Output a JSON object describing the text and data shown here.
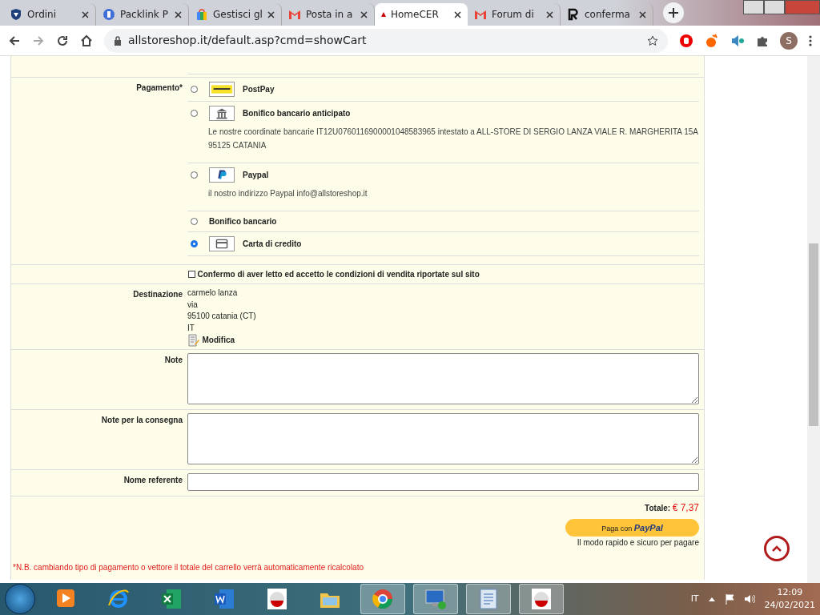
{
  "browser": {
    "tabs": [
      {
        "title": "Ordini",
        "selected": false
      },
      {
        "title": "Packlink P",
        "selected": false
      },
      {
        "title": "Gestisci gl",
        "selected": false
      },
      {
        "title": "Posta in a",
        "selected": false
      },
      {
        "title": "HomeCER",
        "selected": true
      },
      {
        "title": "Forum di",
        "selected": false
      },
      {
        "title": "conferma",
        "selected": false
      }
    ],
    "address": "allstoreshop.it/default.asp?cmd=showCart",
    "profile": "S"
  },
  "payment": {
    "label": "Pagamento*",
    "options": [
      {
        "title": "PostPay",
        "selected": false
      },
      {
        "title": "Bonifico bancario anticipato",
        "note": "Le nostre coordinate bancarie IT12U0760116900001048583965 intestato a ALL-STORE DI SERGIO LANZA VIALE R. MARGHERITA 15A 95125 CATANIA",
        "selected": false
      },
      {
        "title": "Paypal",
        "note": "il nostro indirizzo Paypal info@allstoreshop.it",
        "selected": false
      },
      {
        "title": "Bonifico bancario",
        "selected": false
      },
      {
        "title": "Carta di credito",
        "selected": true
      }
    ]
  },
  "terms": {
    "label": "Confermo di aver letto ed accetto le condizioni di vendita riportate sul sito",
    "checked": false
  },
  "destination": {
    "label": "Destinazione",
    "lines": [
      "carmelo lanza",
      "via",
      "95100 catania (CT)",
      "IT"
    ],
    "edit_link": "Modifica"
  },
  "fields": [
    {
      "label": "Note",
      "kind": "textarea"
    },
    {
      "label": "Note per la consegna",
      "kind": "textarea"
    },
    {
      "label": "Nome referente",
      "kind": "input"
    }
  ],
  "total": {
    "label": "Totale:",
    "value": "€ 7,37"
  },
  "paypal": {
    "prefix": "Paga con",
    "brand": "PayPal",
    "caption": "Il modo rapido e sicuro per pagare"
  },
  "footnote": "*N.B. cambiando tipo di pagamento o vettore il totale del carrello verrà automaticamente ricalcolato",
  "taskbar": {
    "apps": [
      {
        "kind": "media",
        "selected": false
      },
      {
        "kind": "ie",
        "selected": false
      },
      {
        "kind": "excel",
        "selected": false
      },
      {
        "kind": "word",
        "selected": false
      },
      {
        "kind": "app",
        "selected": false
      },
      {
        "kind": "folder",
        "selected": false
      },
      {
        "kind": "chrome",
        "selected": true
      },
      {
        "kind": "remote",
        "selected": true
      },
      {
        "kind": "reader",
        "selected": true
      },
      {
        "kind": "app",
        "selected": true
      }
    ],
    "language": "IT",
    "time": "12:09",
    "date": "24/02/2021"
  }
}
